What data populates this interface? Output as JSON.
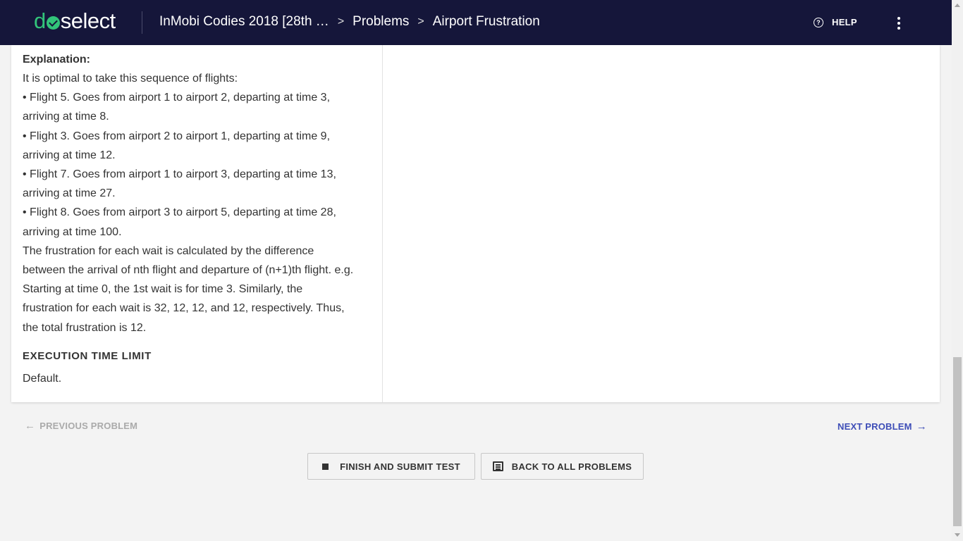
{
  "app": {
    "logo_do": "d",
    "logo_rest": "select"
  },
  "breadcrumb": {
    "contest": "InMobi Codies 2018 [28th …",
    "problems": "Problems",
    "current": "Airport Frustration",
    "separator": ">"
  },
  "header": {
    "help_label": "HELP",
    "help_icon": "?"
  },
  "explanation": {
    "heading": "Explanation:",
    "lines": [
      "It is optimal to take this sequence of flights:",
      "• Flight 5. Goes from airport 1 to airport 2, departing at time 3,",
      "arriving at time 8.",
      "• Flight 3. Goes from airport 2 to airport 1, departing at time 9,",
      "arriving at time 12.",
      "• Flight 7. Goes from airport 1 to airport 3, departing at time 13,",
      "arriving at time 27.",
      "• Flight 8. Goes from airport 3 to airport 5, departing at time 28,",
      "arriving at time 100.",
      "The frustration for each wait is calculated by the difference",
      "between the arrival of nth flight and departure of (n+1)th flight. e.g.",
      "Starting at time 0, the 1st wait is for time 3. Similarly, the",
      "frustration for each wait is 32, 12, 12, and 12, respectively. Thus,",
      "the total frustration is 12."
    ]
  },
  "execution": {
    "heading": "EXECUTION TIME LIMIT",
    "value": "Default."
  },
  "nav": {
    "previous": "PREVIOUS PROBLEM",
    "next": "NEXT PROBLEM"
  },
  "buttons": {
    "finish": "FINISH AND SUBMIT TEST",
    "back": "BACK TO ALL PROBLEMS"
  },
  "colors": {
    "topbar": "#15163a",
    "brand_green": "#32c47a",
    "link_blue": "#3d4db7"
  }
}
